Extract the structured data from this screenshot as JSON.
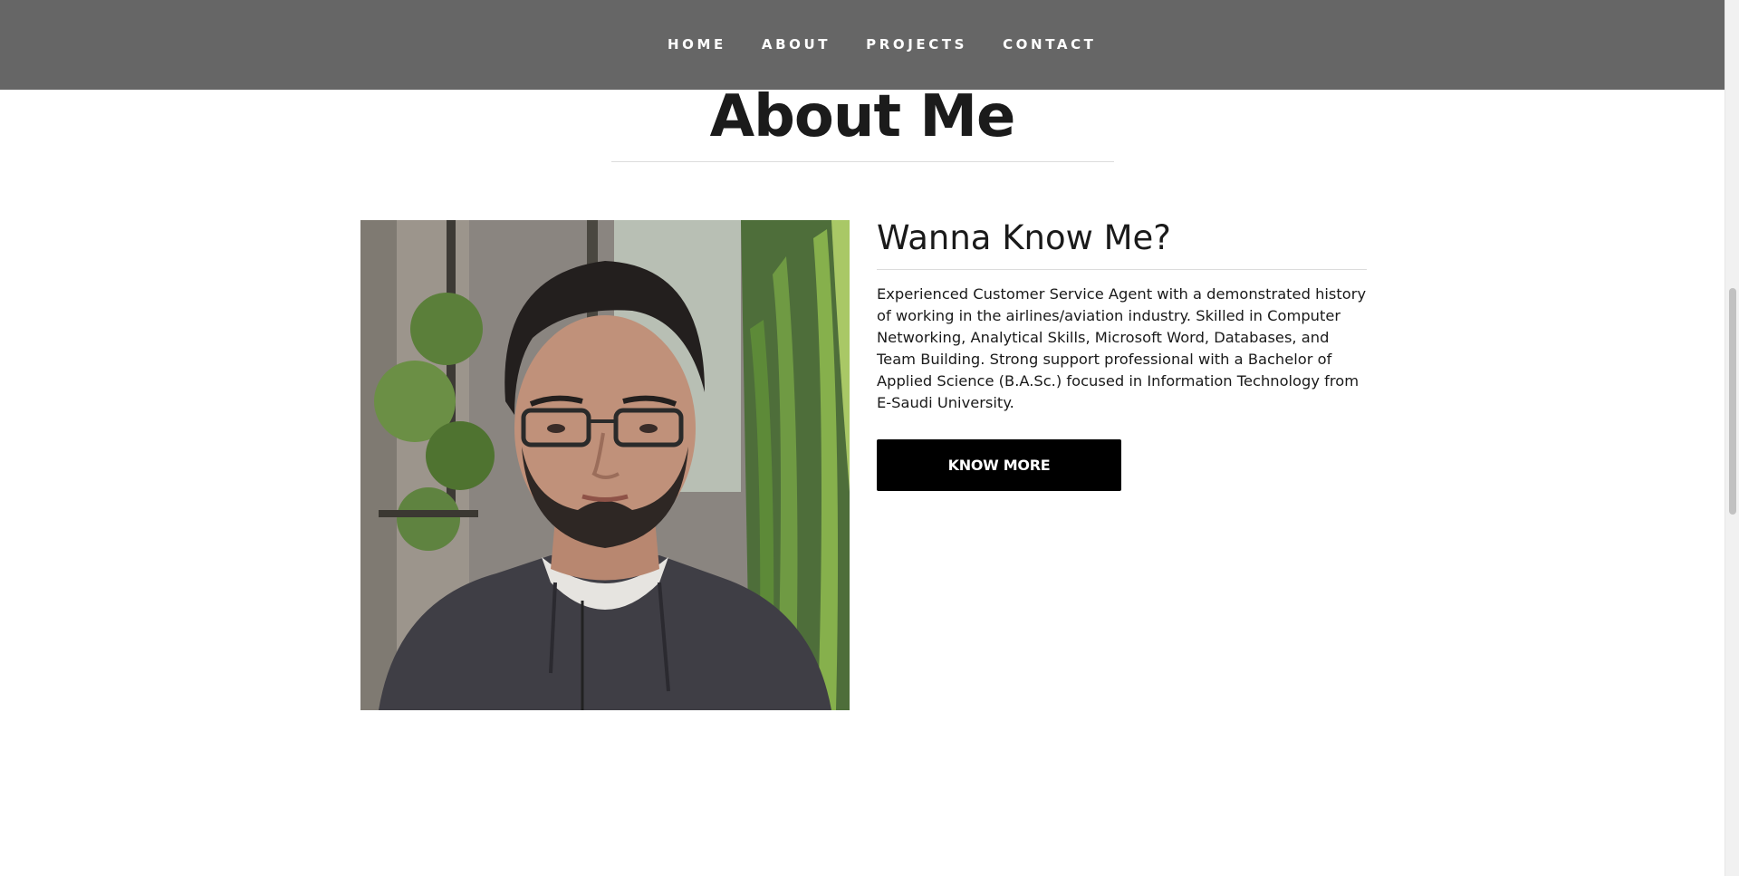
{
  "nav": {
    "items": [
      {
        "label": "HOME"
      },
      {
        "label": "ABOUT"
      },
      {
        "label": "PROJECTS"
      },
      {
        "label": "CONTACT"
      }
    ]
  },
  "about": {
    "title": "About Me",
    "photo_alt": "Portrait photo of a man with glasses and a beard wearing a dark hoodie in front of plants",
    "intro_heading": "Wanna Know Me?",
    "bio": "Experienced Customer Service Agent with a demonstrated history of working in the airlines/aviation industry. Skilled in Computer Networking, Analytical Skills, Microsoft Word, Databases, and Team Building. Strong support professional with a Bachelor of Applied Science (B.A.Sc.) focused in Information Technology from E-Saudi University.",
    "button_label": "KNOW MORE"
  },
  "colors": {
    "navbar_bg": "#666666",
    "button_bg": "#000000",
    "text": "#1a1a1a"
  }
}
